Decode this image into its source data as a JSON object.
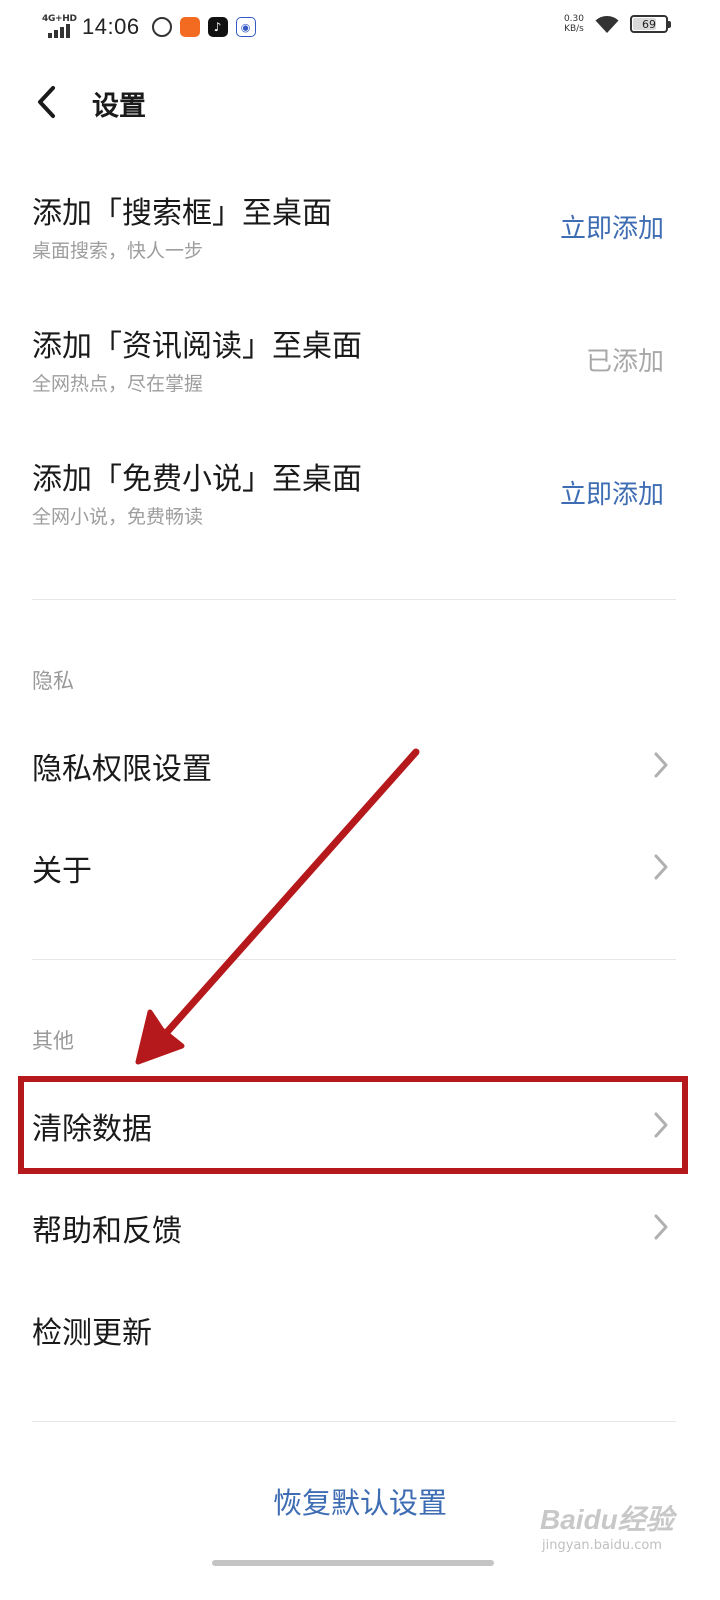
{
  "status_bar": {
    "network": "4G+HD",
    "time": "14:06",
    "speed_value": "0.30",
    "speed_unit": "KB/s",
    "battery": "69"
  },
  "header": {
    "title": "设置"
  },
  "shortcuts": [
    {
      "title": "添加「搜索框」至桌面",
      "subtitle": "桌面搜索，快人一步",
      "action": "立即添加"
    },
    {
      "title": "添加「资讯阅读」至桌面",
      "subtitle": "全网热点，尽在掌握",
      "action": "已添加"
    },
    {
      "title": "添加「免费小说」至桌面",
      "subtitle": "全网小说，免费畅读",
      "action": "立即添加"
    }
  ],
  "privacy": {
    "section_title": "隐私",
    "items": [
      "隐私权限设置",
      "关于"
    ]
  },
  "other": {
    "section_title": "其他",
    "items": [
      "清除数据",
      "帮助和反馈",
      "检测更新"
    ]
  },
  "footer": {
    "restore_label": "恢复默认设置"
  },
  "watermark": {
    "main": "Baidu经验",
    "sub": "jingyan.baidu.com"
  },
  "colors": {
    "accent": "#3f6db3",
    "annotation": "#b5191c",
    "muted": "#a8a8a8"
  }
}
